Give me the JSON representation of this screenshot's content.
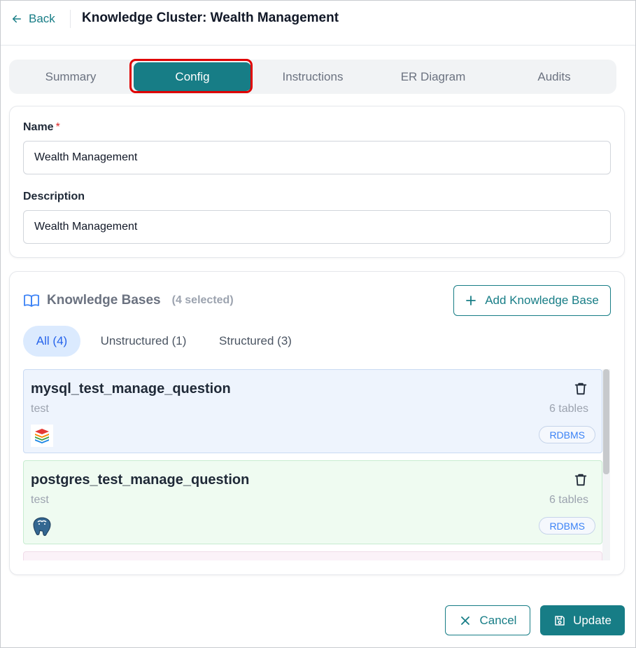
{
  "header": {
    "back_label": "Back",
    "title": "Knowledge Cluster: Wealth Management"
  },
  "tabs": [
    {
      "label": "Summary",
      "active": false
    },
    {
      "label": "Config",
      "active": true
    },
    {
      "label": "Instructions",
      "active": false
    },
    {
      "label": "ER Diagram",
      "active": false
    },
    {
      "label": "Audits",
      "active": false
    }
  ],
  "form": {
    "name_label": "Name",
    "name_required_mark": "*",
    "name_value": "Wealth Management",
    "description_label": "Description",
    "description_value": "Wealth Management"
  },
  "knowledge_bases": {
    "title": "Knowledge Bases",
    "selected_count": "(4 selected)",
    "add_label": "Add Knowledge Base",
    "filters": [
      {
        "label": "All (4)",
        "active": true
      },
      {
        "label": "Unstructured (1)",
        "active": false
      },
      {
        "label": "Structured (3)",
        "active": false
      }
    ],
    "items": [
      {
        "name": "mysql_test_manage_question",
        "description": "test",
        "tables": "6 tables",
        "type": "RDBMS",
        "icon": "mysql-stack-icon"
      },
      {
        "name": "postgres_test_manage_question",
        "description": "test",
        "tables": "6 tables",
        "type": "RDBMS",
        "icon": "postgres-elephant-icon"
      }
    ]
  },
  "footer": {
    "cancel_label": "Cancel",
    "update_label": "Update"
  },
  "colors": {
    "accent": "#177d86",
    "active_filter_bg": "#dbeafe",
    "highlight_outline": "#e00000"
  }
}
